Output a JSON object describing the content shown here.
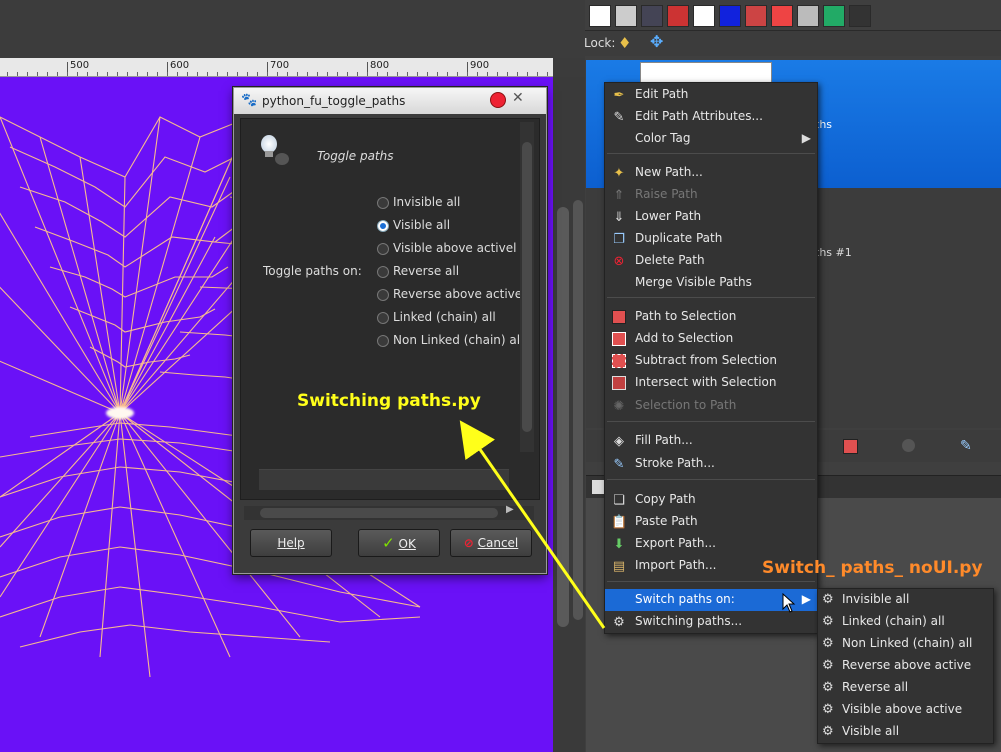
{
  "ruler": {
    "labels": [
      "500",
      "600",
      "700",
      "800",
      "900"
    ]
  },
  "dock": {
    "lock_label": "Lock:",
    "frag_paths": "ths",
    "frag_paths1": "ths #1"
  },
  "dialog": {
    "title": "python_fu_toggle_paths",
    "header": "Toggle paths",
    "field_label": "Toggle paths on:",
    "options": [
      "Invisible all",
      "Visible all",
      "Visible above activel",
      "Reverse all",
      "Reverse above active",
      "Linked (chain) all",
      "Non Linked (chain) all"
    ],
    "selected_index": 1,
    "help_label": "Help",
    "ok_label": "OK",
    "cancel_label": "Cancel"
  },
  "context_menu": {
    "items": [
      {
        "label": "Edit Path",
        "icon": "edit-path-icon"
      },
      {
        "label": "Edit Path Attributes...",
        "icon": "edit-attributes-icon"
      },
      {
        "label": "Color Tag",
        "icon": "",
        "submenu": true
      },
      {
        "label": "New Path...",
        "icon": "new-path-icon"
      },
      {
        "label": "Raise Path",
        "icon": "raise-icon",
        "disabled": true
      },
      {
        "label": "Lower Path",
        "icon": "lower-icon"
      },
      {
        "label": "Duplicate Path",
        "icon": "duplicate-icon"
      },
      {
        "label": "Delete Path",
        "icon": "delete-icon"
      },
      {
        "label": "Merge Visible Paths",
        "icon": ""
      },
      {
        "label": "Path to Selection",
        "icon": "path-to-selection-icon"
      },
      {
        "label": "Add to Selection",
        "icon": "add-selection-icon"
      },
      {
        "label": "Subtract from Selection",
        "icon": "subtract-selection-icon"
      },
      {
        "label": "Intersect with Selection",
        "icon": "intersect-selection-icon"
      },
      {
        "label": "Selection to Path",
        "icon": "selection-to-path-icon",
        "disabled": true
      },
      {
        "label": "Fill Path...",
        "icon": "fill-icon"
      },
      {
        "label": "Stroke Path...",
        "icon": "stroke-icon"
      },
      {
        "label": "Copy Path",
        "icon": "copy-icon"
      },
      {
        "label": "Paste Path",
        "icon": "paste-icon"
      },
      {
        "label": "Export Path...",
        "icon": "export-icon"
      },
      {
        "label": "Import Path...",
        "icon": "import-icon"
      },
      {
        "label": "Switch paths on:",
        "icon": "",
        "submenu": true,
        "selected": true
      },
      {
        "label": "Switching paths...",
        "icon": "script-icon"
      }
    ]
  },
  "submenu": {
    "items": [
      "Invisible all",
      "Linked (chain) all",
      "Non Linked (chain) all",
      "Reverse above active",
      "Reverse all",
      "Visible above active",
      "Visible all"
    ]
  },
  "annotations": {
    "left": "Switching paths.py",
    "right": "Switch_ paths_ noUI.py"
  },
  "colors": {
    "canvas": "#6a11f7",
    "menu_highlight": "#1b6ad6",
    "annotation_left": "#ffff1a",
    "annotation_right": "#ff8a2a"
  }
}
